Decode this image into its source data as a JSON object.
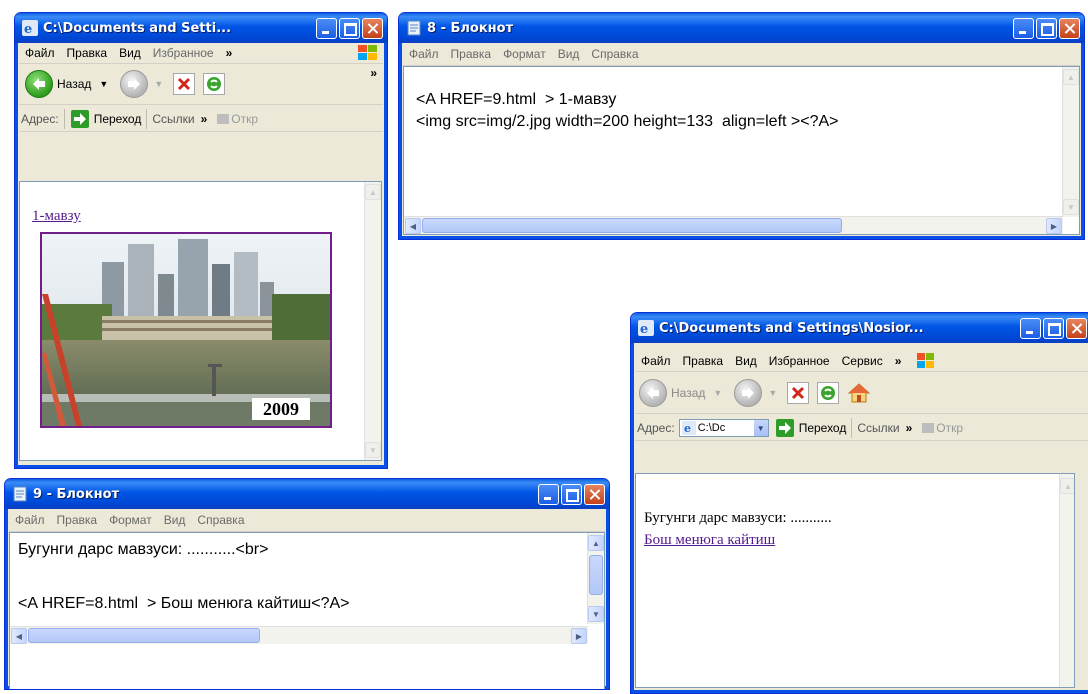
{
  "ie1": {
    "title": "C:\\Documents and Setti...",
    "menu": [
      "Файл",
      "Правка",
      "Вид",
      "Избранное"
    ],
    "menu_more": "»",
    "back_label": "Назад",
    "address_label": "Адрес:",
    "go_label": "Переход",
    "links_label": "Ссылки",
    "links_more": "»",
    "extra_label": "Откр",
    "link_text": "1-мавзу",
    "image_caption": "2009"
  },
  "notepad8": {
    "title": "8 - Блокнот",
    "menu": [
      "Файл",
      "Правка",
      "Формат",
      "Вид",
      "Справка"
    ],
    "lines": [
      "<A HREF=9.html  > 1-мавзу",
      "<img src=img/2.jpg width=200 height=133  align=left ><?A>"
    ]
  },
  "ie2": {
    "title": "C:\\Documents and Settings\\Nosior...",
    "menu": [
      "Файл",
      "Правка",
      "Вид",
      "Избранное",
      "Сервис"
    ],
    "menu_more": "»",
    "back_label": "Назад",
    "address_label": "Адрес:",
    "address_value": "C:\\Dc",
    "go_label": "Переход",
    "links_label": "Ссылки",
    "links_more": "»",
    "extra_label": "Откр",
    "body_text": "Бугунги дарс мавзуси: ...........",
    "link_text": "Бош менюга кайтиш"
  },
  "notepad9": {
    "title": "9 - Блокнот",
    "menu": [
      "Файл",
      "Правка",
      "Формат",
      "Вид",
      "Справка"
    ],
    "lines": [
      "Бугунги дарс мавзуси: ...........<br>",
      "",
      "<A HREF=8.html  > Бош менюга кайтиш<?A>"
    ]
  },
  "colors": {
    "xp_blue": "#0055e5",
    "visited_link": "#551a8b"
  }
}
